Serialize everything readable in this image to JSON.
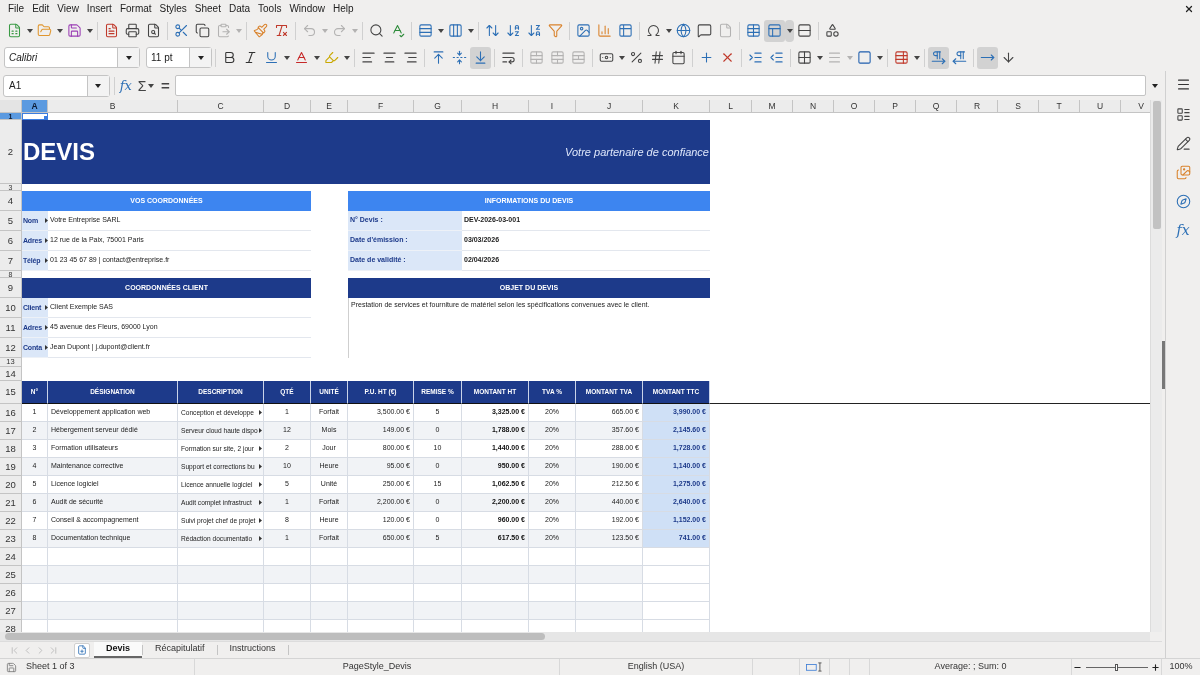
{
  "menu_bar": [
    "File",
    "Edit",
    "View",
    "Insert",
    "Format",
    "Styles",
    "Sheet",
    "Data",
    "Tools",
    "Window",
    "Help"
  ],
  "standard_toolbar": [
    [
      {
        "kind": "new",
        "pressed": false,
        "disabled": false
      },
      {
        "kind": "dropdown",
        "pressed": false,
        "disabled": false
      },
      {
        "kind": "open",
        "pressed": false,
        "disabled": false
      },
      {
        "kind": "dropdown",
        "pressed": false,
        "disabled": false
      },
      {
        "kind": "save",
        "pressed": false,
        "disabled": false
      },
      {
        "kind": "dropdown",
        "pressed": false,
        "disabled": false
      }
    ],
    [
      {
        "kind": "export_pdf",
        "pressed": false,
        "disabled": false
      },
      {
        "kind": "print",
        "pressed": false,
        "disabled": false
      },
      {
        "kind": "print_preview",
        "pressed": false,
        "disabled": false
      }
    ],
    [
      {
        "kind": "cut",
        "pressed": false,
        "disabled": false
      },
      {
        "kind": "copy",
        "pressed": false,
        "disabled": false
      },
      {
        "kind": "paste",
        "pressed": false,
        "disabled": true
      },
      {
        "kind": "dropdown",
        "pressed": false,
        "disabled": true
      }
    ],
    [
      {
        "kind": "clone_formatting",
        "pressed": false,
        "disabled": false
      },
      {
        "kind": "clear_formatting",
        "pressed": false,
        "disabled": false
      }
    ],
    [
      {
        "kind": "undo",
        "pressed": false,
        "disabled": true
      },
      {
        "kind": "dropdown",
        "pressed": false,
        "disabled": true
      },
      {
        "kind": "redo",
        "pressed": false,
        "disabled": true
      },
      {
        "kind": "dropdown",
        "pressed": false,
        "disabled": true
      }
    ],
    [
      {
        "kind": "find_replace",
        "pressed": false,
        "disabled": false
      },
      {
        "kind": "spelling",
        "pressed": false,
        "disabled": false
      }
    ],
    [
      {
        "kind": "rows",
        "pressed": false,
        "disabled": false
      },
      {
        "kind": "dropdown",
        "pressed": false,
        "disabled": false
      },
      {
        "kind": "columns",
        "pressed": false,
        "disabled": false
      },
      {
        "kind": "dropdown",
        "pressed": false,
        "disabled": false
      }
    ],
    [
      {
        "kind": "sort",
        "pressed": false,
        "disabled": false
      },
      {
        "kind": "sort_ascending",
        "pressed": false,
        "disabled": false
      },
      {
        "kind": "sort_descending",
        "pressed": false,
        "disabled": false
      },
      {
        "kind": "autofilter",
        "pressed": false,
        "disabled": false
      }
    ],
    [
      {
        "kind": "image",
        "pressed": false,
        "disabled": false
      },
      {
        "kind": "chart",
        "pressed": false,
        "disabled": false
      },
      {
        "kind": "pivot_table",
        "pressed": false,
        "disabled": false
      }
    ],
    [
      {
        "kind": "special_character",
        "pressed": false,
        "disabled": false
      },
      {
        "kind": "dropdown",
        "pressed": false,
        "disabled": false
      },
      {
        "kind": "hyperlink",
        "pressed": false,
        "disabled": false
      },
      {
        "kind": "comment",
        "pressed": false,
        "disabled": false
      },
      {
        "kind": "header_footer",
        "pressed": false,
        "disabled": true
      }
    ],
    [
      {
        "kind": "print_area",
        "pressed": false,
        "disabled": false
      },
      {
        "kind": "freeze",
        "pressed": true,
        "disabled": false
      },
      {
        "kind": "dropdown",
        "pressed": true,
        "disabled": false
      },
      {
        "kind": "split_window",
        "pressed": false,
        "disabled": false
      }
    ],
    [
      {
        "kind": "draw_functions",
        "pressed": false,
        "disabled": false
      }
    ]
  ],
  "formatting_toolbar": [
    [
      {
        "kind": "font_name",
        "value": "Calibri",
        "pressed": false,
        "disabled": false
      },
      {
        "kind": "font_size",
        "value": "11 pt",
        "pressed": false,
        "disabled": false
      }
    ],
    [
      {
        "kind": "bold",
        "pressed": false,
        "disabled": false
      },
      {
        "kind": "italic",
        "pressed": false,
        "disabled": false
      },
      {
        "kind": "underline",
        "pressed": false,
        "disabled": false
      },
      {
        "kind": "dropdown",
        "pressed": false,
        "disabled": false
      },
      {
        "kind": "font_color",
        "pressed": false,
        "disabled": false
      },
      {
        "kind": "dropdown",
        "pressed": false,
        "disabled": false
      },
      {
        "kind": "highlighting",
        "pressed": false,
        "disabled": false
      },
      {
        "kind": "dropdown",
        "pressed": false,
        "disabled": false
      }
    ],
    [
      {
        "kind": "align_left",
        "pressed": false,
        "disabled": false
      },
      {
        "kind": "align_center",
        "pressed": false,
        "disabled": false
      },
      {
        "kind": "align_right",
        "pressed": false,
        "disabled": false
      }
    ],
    [
      {
        "kind": "align_top",
        "pressed": false,
        "disabled": false
      },
      {
        "kind": "center_vertically",
        "pressed": false,
        "disabled": false
      },
      {
        "kind": "align_bottom",
        "pressed": true,
        "disabled": false
      }
    ],
    [
      {
        "kind": "wrap_text",
        "pressed": false,
        "disabled": false
      }
    ],
    [
      {
        "kind": "merge_center",
        "pressed": false,
        "disabled": true
      },
      {
        "kind": "merge",
        "pressed": false,
        "disabled": true
      },
      {
        "kind": "unmerge",
        "pressed": false,
        "disabled": true
      }
    ],
    [
      {
        "kind": "currency",
        "pressed": false,
        "disabled": false
      },
      {
        "kind": "dropdown",
        "pressed": false,
        "disabled": false
      },
      {
        "kind": "percent",
        "pressed": false,
        "disabled": false
      },
      {
        "kind": "number",
        "pressed": false,
        "disabled": false
      },
      {
        "kind": "date",
        "pressed": false,
        "disabled": false
      }
    ],
    [
      {
        "kind": "add_decimal",
        "pressed": false,
        "disabled": false
      },
      {
        "kind": "delete_decimal",
        "pressed": false,
        "disabled": false
      }
    ],
    [
      {
        "kind": "increase_indent",
        "pressed": false,
        "disabled": false
      },
      {
        "kind": "decrease_indent",
        "pressed": false,
        "disabled": false
      }
    ],
    [
      {
        "kind": "borders",
        "pressed": false,
        "disabled": false
      },
      {
        "kind": "dropdown",
        "pressed": false,
        "disabled": false
      },
      {
        "kind": "border_style",
        "pressed": false,
        "disabled": true
      },
      {
        "kind": "dropdown",
        "pressed": false,
        "disabled": true
      },
      {
        "kind": "border_color",
        "pressed": false,
        "disabled": false
      },
      {
        "kind": "dropdown",
        "pressed": false,
        "disabled": false
      }
    ],
    [
      {
        "kind": "conditional",
        "pressed": false,
        "disabled": false
      },
      {
        "kind": "dropdown",
        "pressed": false,
        "disabled": false
      }
    ],
    [
      {
        "kind": "left_to_right",
        "pressed": true,
        "disabled": false
      },
      {
        "kind": "right_to_left",
        "pressed": false,
        "disabled": false
      }
    ],
    [
      {
        "kind": "text_left_right",
        "pressed": true,
        "disabled": false
      },
      {
        "kind": "text_top_bottom",
        "pressed": false,
        "disabled": false
      }
    ]
  ],
  "formula_bar": {
    "name_box": "A1",
    "function_wizard": "fx",
    "sum": "Σ",
    "equals": "="
  },
  "sidebar": [
    {
      "kind": "menu"
    },
    {
      "kind": "properties"
    },
    {
      "kind": "styles"
    },
    {
      "kind": "gallery"
    },
    {
      "kind": "navigator"
    },
    {
      "kind": "functions",
      "label": "fx"
    }
  ],
  "sheet": {
    "columns": [
      {
        "label": "A",
        "selected": true
      },
      {
        "label": "B",
        "selected": false
      },
      {
        "label": "C",
        "selected": false
      },
      {
        "label": "D",
        "selected": false
      },
      {
        "label": "E",
        "selected": false
      },
      {
        "label": "F",
        "selected": false
      },
      {
        "label": "G",
        "selected": false
      },
      {
        "label": "H",
        "selected": false
      },
      {
        "label": "I",
        "selected": false
      },
      {
        "label": "J",
        "selected": false
      },
      {
        "label": "K",
        "selected": false
      },
      {
        "label": "L",
        "selected": false
      },
      {
        "label": "M",
        "selected": false
      },
      {
        "label": "N",
        "selected": false
      },
      {
        "label": "O",
        "selected": false
      },
      {
        "label": "P",
        "selected": false
      },
      {
        "label": "Q",
        "selected": false
      },
      {
        "label": "R",
        "selected": false
      },
      {
        "label": "S",
        "selected": false
      },
      {
        "label": "T",
        "selected": false
      },
      {
        "label": "U",
        "selected": false
      },
      {
        "label": "V",
        "selected": false
      }
    ],
    "rows": [
      {
        "label": "1",
        "selected": true
      },
      {
        "label": "2",
        "selected": false
      },
      {
        "label": "3",
        "selected": false
      },
      {
        "label": "4",
        "selected": false
      },
      {
        "label": "5",
        "selected": false
      },
      {
        "label": "6",
        "selected": false
      },
      {
        "label": "7",
        "selected": false
      },
      {
        "label": "8",
        "selected": false
      },
      {
        "label": "9",
        "selected": false
      },
      {
        "label": "10",
        "selected": false
      },
      {
        "label": "11",
        "selected": false
      },
      {
        "label": "12",
        "selected": false
      },
      {
        "label": "13",
        "selected": false
      },
      {
        "label": "14",
        "selected": false
      },
      {
        "label": "15",
        "selected": false
      },
      {
        "label": "16",
        "selected": false
      },
      {
        "label": "17",
        "selected": false
      },
      {
        "label": "18",
        "selected": false
      },
      {
        "label": "19",
        "selected": false
      },
      {
        "label": "20",
        "selected": false
      },
      {
        "label": "21",
        "selected": false
      },
      {
        "label": "22",
        "selected": false
      },
      {
        "label": "23",
        "selected": false
      },
      {
        "label": "24",
        "selected": false
      },
      {
        "label": "25",
        "selected": false
      },
      {
        "label": "26",
        "selected": false
      },
      {
        "label": "27",
        "selected": false
      },
      {
        "label": "28",
        "selected": false
      }
    ],
    "title": "DEVIS",
    "tagline": "Votre partenaire de confiance",
    "sender": {
      "heading": "VOS COORDONNÉES",
      "fields": [
        {
          "label": "Nom",
          "clipped": true,
          "value": "Votre Entreprise SARL"
        },
        {
          "label": "Adres",
          "clipped": true,
          "value": "12 rue de la Paix, 75001 Paris"
        },
        {
          "label": "Télép",
          "clipped": true,
          "value": "01 23 45 67 89 | contact@entreprise.fr"
        }
      ]
    },
    "quote_info": {
      "heading": "INFORMATIONS DU DEVIS",
      "fields": [
        {
          "label": "N° Devis :",
          "value": "DEV-2026-03-001"
        },
        {
          "label": "Date d'émission :",
          "value": "03/03/2026"
        },
        {
          "label": "Date de validité :",
          "value": "02/04/2026"
        }
      ]
    },
    "client": {
      "heading": "COORDONNÉES CLIENT",
      "fields": [
        {
          "label": "Client",
          "clipped": true,
          "value": "Client Exemple SAS"
        },
        {
          "label": "Adres",
          "clipped": true,
          "value": "45 avenue des Fleurs, 69000 Lyon"
        },
        {
          "label": "Conta",
          "clipped": true,
          "value": "Jean Dupont | j.dupont@client.fr"
        }
      ]
    },
    "subject": {
      "heading": "OBJET DU DEVIS",
      "text": "Prestation de services et fourniture de matériel selon les spécifications convenues avec le client."
    },
    "items_table": {
      "columns": [
        "N°",
        "DÉSIGNATION",
        "DESCRIPTION",
        "QTÉ",
        "UNITÉ",
        "P.U. HT (€)",
        "REMISE %",
        "MONTANT HT",
        "TVA %",
        "MONTANT TVA",
        "MONTANT TTC"
      ],
      "rows": [
        {
          "cells": [
            "1",
            "Développement application web",
            "Conception et développe",
            "1",
            "Forfait",
            "3,500.00 €",
            "5",
            "3,325.00 €",
            "20%",
            "665.00 €",
            "3,990.00 €"
          ],
          "description_clipped": true
        },
        {
          "cells": [
            "2",
            "Hébergement serveur dédié",
            "Serveur cloud haute dispo",
            "12",
            "Mois",
            "149.00 €",
            "0",
            "1,788.00 €",
            "20%",
            "357.60 €",
            "2,145.60 €"
          ],
          "description_clipped": true
        },
        {
          "cells": [
            "3",
            "Formation utilisateurs",
            "Formation sur site, 2 jour",
            "2",
            "Jour",
            "800.00 €",
            "10",
            "1,440.00 €",
            "20%",
            "288.00 €",
            "1,728.00 €"
          ],
          "description_clipped": true
        },
        {
          "cells": [
            "4",
            "Maintenance corrective",
            "Support et corrections bu",
            "10",
            "Heure",
            "95.00 €",
            "0",
            "950.00 €",
            "20%",
            "190.00 €",
            "1,140.00 €"
          ],
          "description_clipped": true
        },
        {
          "cells": [
            "5",
            "Licence logiciel",
            "Licence annuelle logiciel",
            "5",
            "Unité",
            "250.00 €",
            "15",
            "1,062.50 €",
            "20%",
            "212.50 €",
            "1,275.00 €"
          ],
          "description_clipped": true
        },
        {
          "cells": [
            "6",
            "Audit de sécurité",
            "Audit complet infrastruct",
            "1",
            "Forfait",
            "2,200.00 €",
            "0",
            "2,200.00 €",
            "20%",
            "440.00 €",
            "2,640.00 €"
          ],
          "description_clipped": true
        },
        {
          "cells": [
            "7",
            "Conseil & accompagnement",
            "Suivi projet chef de projet",
            "8",
            "Heure",
            "120.00 €",
            "0",
            "960.00 €",
            "20%",
            "192.00 €",
            "1,152.00 €"
          ],
          "description_clipped": true
        },
        {
          "cells": [
            "8",
            "Documentation technique",
            "Rédaction documentatio",
            "1",
            "Forfait",
            "650.00 €",
            "5",
            "617.50 €",
            "20%",
            "123.50 €",
            "741.00 €"
          ],
          "description_clipped": true
        }
      ]
    }
  },
  "sheet_navigation": [
    {
      "kind": "first",
      "disabled": true
    },
    {
      "kind": "previous",
      "disabled": true
    },
    {
      "kind": "next",
      "disabled": true
    },
    {
      "kind": "last",
      "disabled": true
    }
  ],
  "sheet_tabs": [
    {
      "label": "Devis",
      "selected": true
    },
    {
      "label": "Récapitulatif",
      "selected": false
    },
    {
      "label": "Instructions",
      "selected": false
    }
  ],
  "status_bar": {
    "sheet_position": "Sheet 1 of 3",
    "page_style": "PageStyle_Devis",
    "language": "English (USA)",
    "selection_summary": "Average: ; Sum: 0",
    "zoom": {
      "level": 0.5,
      "reading": "100%"
    }
  }
}
